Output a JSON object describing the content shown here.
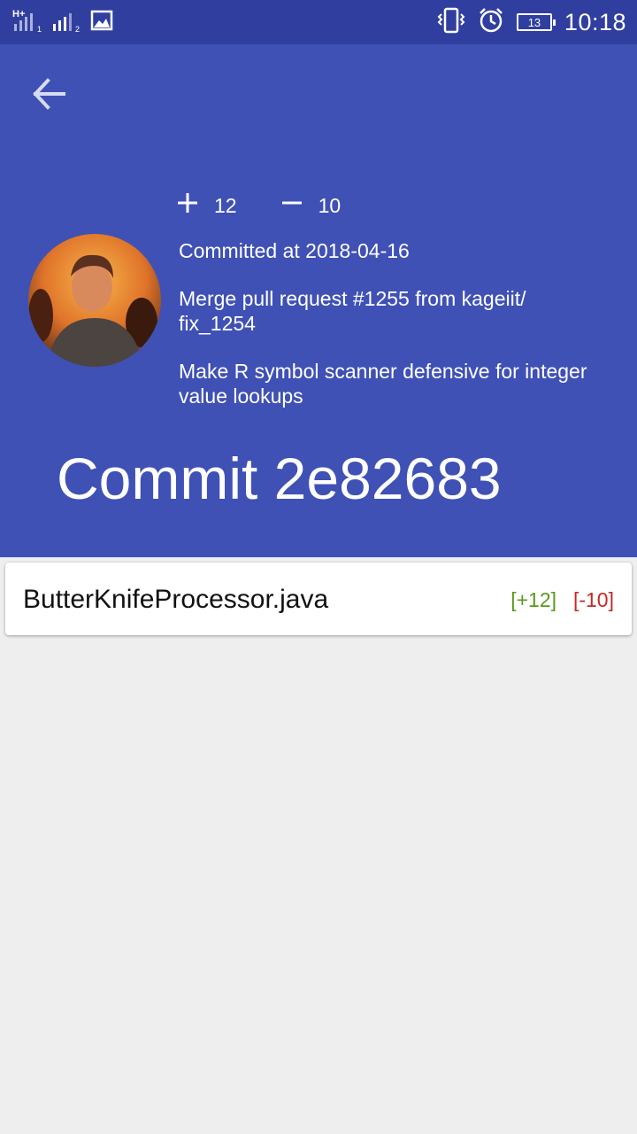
{
  "status_bar": {
    "network_1": "H+",
    "sim_1": "1",
    "sim_2": "2",
    "battery_level": "13",
    "time": "10:18",
    "icons": [
      "h-plus-signal-icon",
      "signal-sim1-icon",
      "signal-sim2-icon",
      "gallery-notification-icon",
      "vibrate-icon",
      "alarm-icon",
      "battery-icon"
    ]
  },
  "header": {
    "back_icon": "arrow-back-icon",
    "additions": "12",
    "deletions": "10",
    "committed_at": "Committed at 2018-04-16",
    "message_line1": "Merge pull request #1255 from kageiit/ fix_1254",
    "message_line2": "Make R symbol scanner defensive for integer value lookups",
    "title": "Commit 2e82683",
    "color": "#3f51b5",
    "status_color": "#303f9f"
  },
  "files": [
    {
      "name": "ButterKnifeProcessor.java",
      "additions": "[+12]",
      "deletions": "[-10]",
      "add_color": "#5a9a1a",
      "del_color": "#c62828"
    }
  ]
}
